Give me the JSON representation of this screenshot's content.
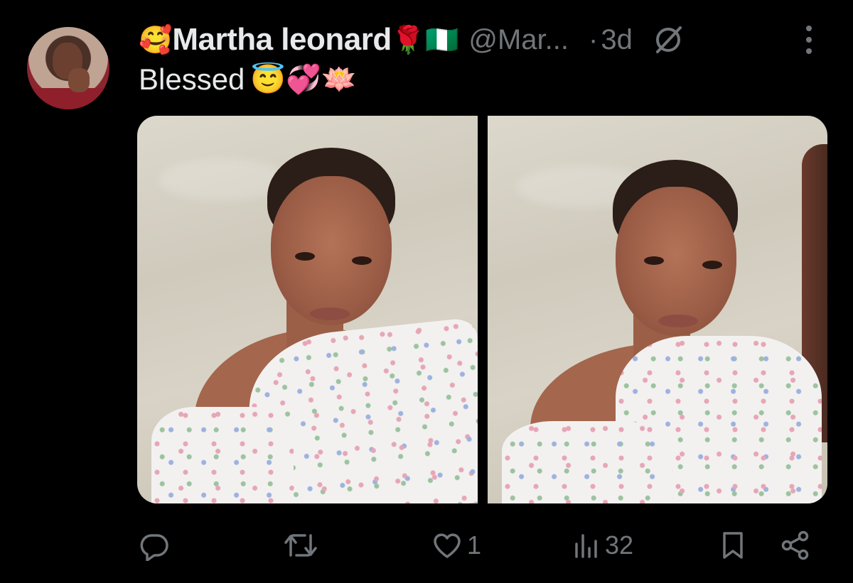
{
  "author": {
    "prefix_emoji": "🥰",
    "name": "Martha leonard",
    "badge_emoji_1": "🌹",
    "badge_emoji_2": "🇳🇬",
    "handle": "@Mar...",
    "separator": "·",
    "time": "3d"
  },
  "tweet": {
    "text": "Blessed",
    "emojis": "😇💞🪷"
  },
  "media": {
    "count": 2
  },
  "actions": {
    "reply_count": "",
    "retweet_count": "",
    "like_count": "1",
    "views_count": "32"
  },
  "icons": [
    "grok-icon",
    "more-icon",
    "reply-icon",
    "retweet-icon",
    "like-icon",
    "views-icon",
    "bookmark-icon",
    "share-icon"
  ],
  "colors": {
    "background": "#000000",
    "text": "#e7e9ea",
    "muted": "#71767b"
  }
}
